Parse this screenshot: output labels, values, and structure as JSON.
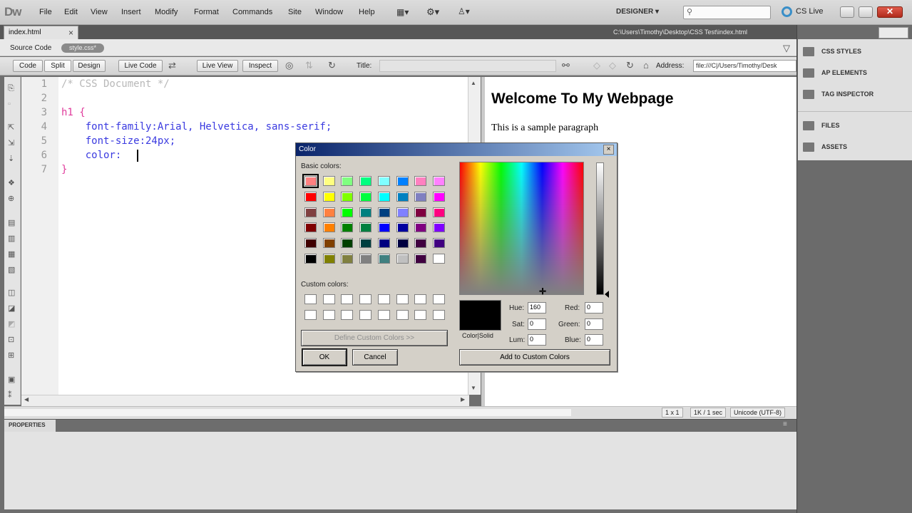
{
  "app": {
    "logo": "Dw",
    "menu": [
      "File",
      "Edit",
      "View",
      "Insert",
      "Modify",
      "Format",
      "Commands",
      "Site",
      "Window",
      "Help"
    ],
    "workspace": "DESIGNER ▾",
    "cs_live": "CS Live"
  },
  "document": {
    "tab": "index.html",
    "path": "C:\\Users\\Timothy\\Desktop\\CSS Test\\index.html",
    "source_code_label": "Source Code",
    "related_file": "style.css*"
  },
  "toolbar": {
    "code": "Code",
    "split": "Split",
    "design": "Design",
    "live_code": "Live Code",
    "live_view": "Live View",
    "inspect": "Inspect",
    "title_label": "Title:",
    "address_label": "Address:",
    "address_value": "file:///C|/Users/Timothy/Desk"
  },
  "code": {
    "line_numbers": [
      "1",
      "2",
      "3",
      "4",
      "5",
      "6",
      "7"
    ],
    "lines": [
      "/* CSS Document */",
      "",
      "h1 {",
      "    font-family:Arial, Helvetica, sans-serif;",
      "    font-size:24px;",
      "    color:",
      "}"
    ]
  },
  "design_view": {
    "heading": "Welcome To My Webpage",
    "paragraph": "This is a sample paragraph"
  },
  "status": {
    "dimensions": "1 x 1",
    "download": "1K / 1 sec",
    "encoding": "Unicode (UTF-8)"
  },
  "properties": {
    "label": "PROPERTIES"
  },
  "panels": [
    "CSS STYLES",
    "AP ELEMENTS",
    "TAG INSPECTOR",
    "FILES",
    "ASSETS"
  ],
  "color_dialog": {
    "title": "Color",
    "basic_colors_label": "Basic colors:",
    "custom_colors_label": "Custom colors:",
    "define_custom_button": "Define Custom Colors >>",
    "ok_button": "OK",
    "cancel_button": "Cancel",
    "color_solid_label": "Color|Solid",
    "add_custom_button": "Add to Custom Colors",
    "hue_label": "Hue:",
    "sat_label": "Sat:",
    "lum_label": "Lum:",
    "red_label": "Red:",
    "green_label": "Green:",
    "blue_label": "Blue:",
    "hue": "160",
    "sat": "0",
    "lum": "0",
    "red": "0",
    "green": "0",
    "blue": "0",
    "basic_colors": [
      "#ff8080",
      "#ffff80",
      "#80ff80",
      "#00ff80",
      "#80ffff",
      "#0080ff",
      "#ff80c0",
      "#ff80ff",
      "#ff0000",
      "#ffff00",
      "#80ff00",
      "#00ff40",
      "#00ffff",
      "#0080c0",
      "#8080c0",
      "#ff00ff",
      "#804040",
      "#ff8040",
      "#00ff00",
      "#008080",
      "#004080",
      "#8080ff",
      "#800040",
      "#ff0080",
      "#800000",
      "#ff8000",
      "#008000",
      "#008040",
      "#0000ff",
      "#0000a0",
      "#800080",
      "#8000ff",
      "#400000",
      "#804000",
      "#004000",
      "#004040",
      "#000080",
      "#000040",
      "#400040",
      "#400080",
      "#000000",
      "#808000",
      "#808040",
      "#808080",
      "#408080",
      "#c0c0c0",
      "#400040",
      "#ffffff"
    ]
  }
}
